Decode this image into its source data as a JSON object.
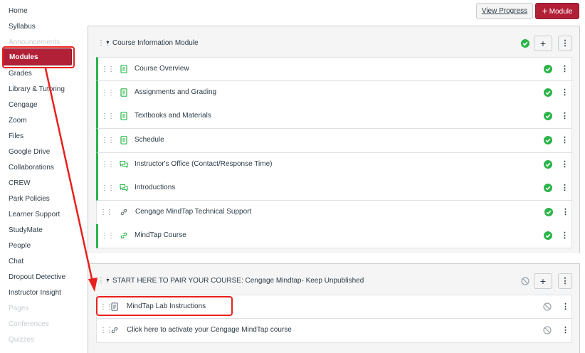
{
  "nav": {
    "items": [
      {
        "label": "Home",
        "state": "normal"
      },
      {
        "label": "Syllabus",
        "state": "normal"
      },
      {
        "label": "Announcements",
        "state": "disabled"
      },
      {
        "label": "Modules",
        "state": "active"
      },
      {
        "label": "Grades",
        "state": "normal"
      },
      {
        "label": "Library & Tutoring",
        "state": "normal"
      },
      {
        "label": "Cengage",
        "state": "normal"
      },
      {
        "label": "Zoom",
        "state": "normal"
      },
      {
        "label": "Files",
        "state": "normal"
      },
      {
        "label": "Google Drive",
        "state": "normal"
      },
      {
        "label": "Collaborations",
        "state": "normal"
      },
      {
        "label": "CREW",
        "state": "normal"
      },
      {
        "label": "Park Policies",
        "state": "normal"
      },
      {
        "label": "Learner Support",
        "state": "normal"
      },
      {
        "label": "StudyMate",
        "state": "normal"
      },
      {
        "label": "People",
        "state": "normal"
      },
      {
        "label": "Chat",
        "state": "normal"
      },
      {
        "label": "Dropout Detective",
        "state": "normal"
      },
      {
        "label": "Instructor Insight",
        "state": "normal"
      },
      {
        "label": "Pages",
        "state": "disabled"
      },
      {
        "label": "Conferences",
        "state": "disabled"
      },
      {
        "label": "Quizzes",
        "state": "disabled"
      }
    ]
  },
  "toolbar": {
    "view_progress_label": "View Progress",
    "add_module_label": "Module",
    "add_module_icon": "plus-icon"
  },
  "modules": [
    {
      "title": "Course Information Module",
      "published": true,
      "items": [
        {
          "title": "Course Overview",
          "icon": "page-icon",
          "published": true
        },
        {
          "title": "Assignments and Grading",
          "icon": "page-icon",
          "published": true
        },
        {
          "title": "Textbooks and Materials",
          "icon": "page-icon",
          "published": true
        },
        {
          "title": "Schedule",
          "icon": "page-icon",
          "published": true
        },
        {
          "title": "Instructor's Office (Contact/Response Time)",
          "icon": "discussion-icon",
          "published": true
        },
        {
          "title": "Introductions",
          "icon": "discussion-icon",
          "published": true
        },
        {
          "title": "Cengage MindTap Technical Support",
          "icon": "link-icon",
          "published": true
        },
        {
          "title": "MindTap Course",
          "icon": "link-icon",
          "published": true
        }
      ]
    },
    {
      "title": "START HERE TO PAIR YOUR COURSE: Cengage Mindtap- Keep Unpublished",
      "published": false,
      "items": [
        {
          "title": "MindTap Lab Instructions",
          "icon": "page-icon",
          "published": false
        },
        {
          "title": "Click here to activate your Cengage MindTap course",
          "icon": "link-icon",
          "published": false
        }
      ]
    }
  ],
  "colors": {
    "brand": "#b22038",
    "published_green": "#2bb44a",
    "unpublished_gray": "#9aa3a9",
    "annotation_red": "#e8201c"
  }
}
